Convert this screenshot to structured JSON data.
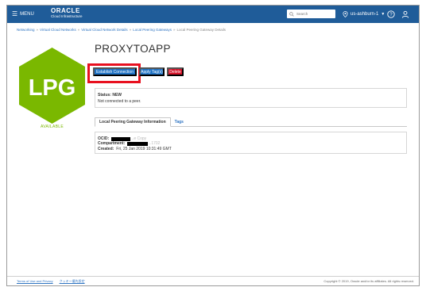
{
  "header": {
    "menu_label": "MENU",
    "menu_icon": "hamburger-icon",
    "brand": "ORACLE",
    "brand_sub": "Cloud Infrastructure",
    "search_placeholder": "Search",
    "region": "us-ashburn-1",
    "help_icon": "help-icon",
    "user_icon": "user-icon",
    "bar_color": "#1f5c99"
  },
  "breadcrumb": {
    "items": [
      "Networking",
      "Virtual Cloud Networks",
      "Virtual Cloud Network Details",
      "Local Peering Gateways"
    ],
    "current": "Local Peering Gateway Details",
    "separator": "»"
  },
  "resource": {
    "icon_text": "LPG",
    "icon_color": "#7ab800",
    "state": "AVAILABLE",
    "name": "PROXYTOAPP"
  },
  "actions": {
    "establish": "Establish Connection",
    "apply_tags": "Apply Tag(s)",
    "delete": "Delete",
    "highlight_color": "#e8101f"
  },
  "status": {
    "label": "Status:",
    "value": "NEW",
    "message": "Not connected to a peer."
  },
  "tabs": {
    "info": "Local Peering Gateway Information",
    "tags": "Tags"
  },
  "info": {
    "ocid_label": "OCID:",
    "ocid_partial": "...e Copy",
    "compartment_label": "Compartment:",
    "compartment_partial": "...1702",
    "created_label": "Created:",
    "created_value": "Fri, 25 Jan 2019 10:31:49 GMT"
  },
  "footer": {
    "terms": "Terms of Use and Privacy",
    "cookie": "クッキー優先設定",
    "copyright": "Copyright © 2019, Oracle and/or its affiliates. All rights reserved."
  }
}
